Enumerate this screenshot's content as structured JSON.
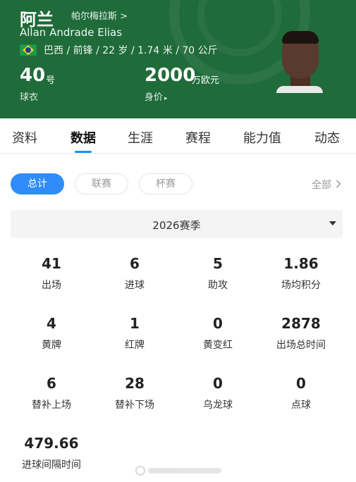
{
  "player": {
    "name_cn": "阿兰",
    "club": "帕尔梅拉斯 >",
    "name_en": "Allan Andrade Elias",
    "meta": "巴西 / 前锋 / 22 岁 / 1.74 米 / 70 公斤",
    "number": "40",
    "number_unit": "号",
    "number_label": "球衣",
    "value": "2000",
    "value_unit": "万欧元",
    "value_label": "身价",
    "value_caret": "▸",
    "flag_icon": "brazil-flag-icon",
    "theme_color": "#1f6b3a"
  },
  "tabs": [
    "资料",
    "数据",
    "生涯",
    "赛程",
    "能力值",
    "动态"
  ],
  "active_tab": "数据",
  "filters": {
    "chips": [
      "总计",
      "联赛",
      "杯赛"
    ],
    "active": "总计",
    "all_label": "全部",
    "all_icon": "chevron-right-icon",
    "accent": "#2f8cf9"
  },
  "season": {
    "label": "2026赛季",
    "caret_icon": "caret-down-icon"
  },
  "stats": [
    {
      "value": "41",
      "label": "出场"
    },
    {
      "value": "6",
      "label": "进球"
    },
    {
      "value": "5",
      "label": "助攻"
    },
    {
      "value": "1.86",
      "label": "场均积分"
    },
    {
      "value": "4",
      "label": "黄牌"
    },
    {
      "value": "1",
      "label": "红牌"
    },
    {
      "value": "0",
      "label": "黄变红"
    },
    {
      "value": "2878",
      "label": "出场总时间"
    },
    {
      "value": "6",
      "label": "替补上场"
    },
    {
      "value": "28",
      "label": "替补下场"
    },
    {
      "value": "0",
      "label": "乌龙球"
    },
    {
      "value": "0",
      "label": "点球"
    },
    {
      "value": "479.66",
      "label": "进球间隔时间"
    }
  ]
}
